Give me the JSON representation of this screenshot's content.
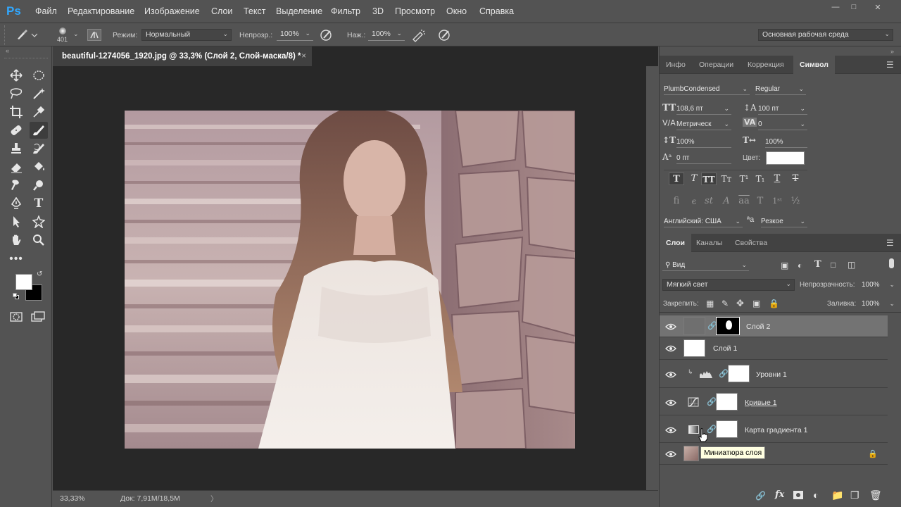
{
  "app": {
    "logo": "Ps"
  },
  "menu": [
    "Файл",
    "Редактирование",
    "Изображение",
    "Слои",
    "Текст",
    "Выделение",
    "Фильтр",
    "3D",
    "Просмотр",
    "Окно",
    "Справка"
  ],
  "options": {
    "brush_size": "401",
    "mode_label": "Режим:",
    "mode_value": "Нормальный",
    "opacity_label": "Непрозр.:",
    "opacity_value": "100%",
    "pressure_label": "Наж.:",
    "pressure_value": "100%",
    "workspace": "Основная рабочая среда"
  },
  "colors": {
    "foreground": "#ffffff",
    "background": "#000000",
    "accent": "#31a8ff"
  },
  "document": {
    "tab_title": "beautiful-1274056_1920.jpg @ 33,3% (Слой 2, Слой-маска/8) *",
    "close": "×",
    "zoom": "33,33%",
    "doc_info": "Док: 7,91M/18,5M",
    "arrow": "〉"
  },
  "top_panel": {
    "tabs": [
      "Инфо",
      "Операции",
      "Коррекция",
      "Символ"
    ],
    "active_tab": 3,
    "font_family": "PlumbCondensed",
    "font_style": "Regular",
    "font_size": "108,6 пт",
    "leading": "100 пт",
    "kerning": "Метрическ",
    "tracking": "0",
    "vscale": "100%",
    "hscale": "100%",
    "baseline": "0 пт",
    "color_label": "Цвет:",
    "language": "Английский: США",
    "antialias": "Резкое",
    "aa_icon": "ªa"
  },
  "layers_panel": {
    "tabs": [
      "Слои",
      "Каналы",
      "Свойства"
    ],
    "active_tab": 0,
    "filter": "Вид",
    "blend_mode": "Мягкий свет",
    "opacity_label": "Непрозрачность:",
    "opacity_value": "100%",
    "lock_label": "Закрепить:",
    "fill_label": "Заливка:",
    "fill_value": "100%",
    "layers": [
      {
        "name": "Слой 2"
      },
      {
        "name": "Слой 1"
      },
      {
        "name": "Уровни 1"
      },
      {
        "name": "Кривые 1"
      },
      {
        "name": "Карта градиента 1"
      },
      {
        "name": ""
      }
    ],
    "tooltip": "Миниатюра слоя"
  }
}
